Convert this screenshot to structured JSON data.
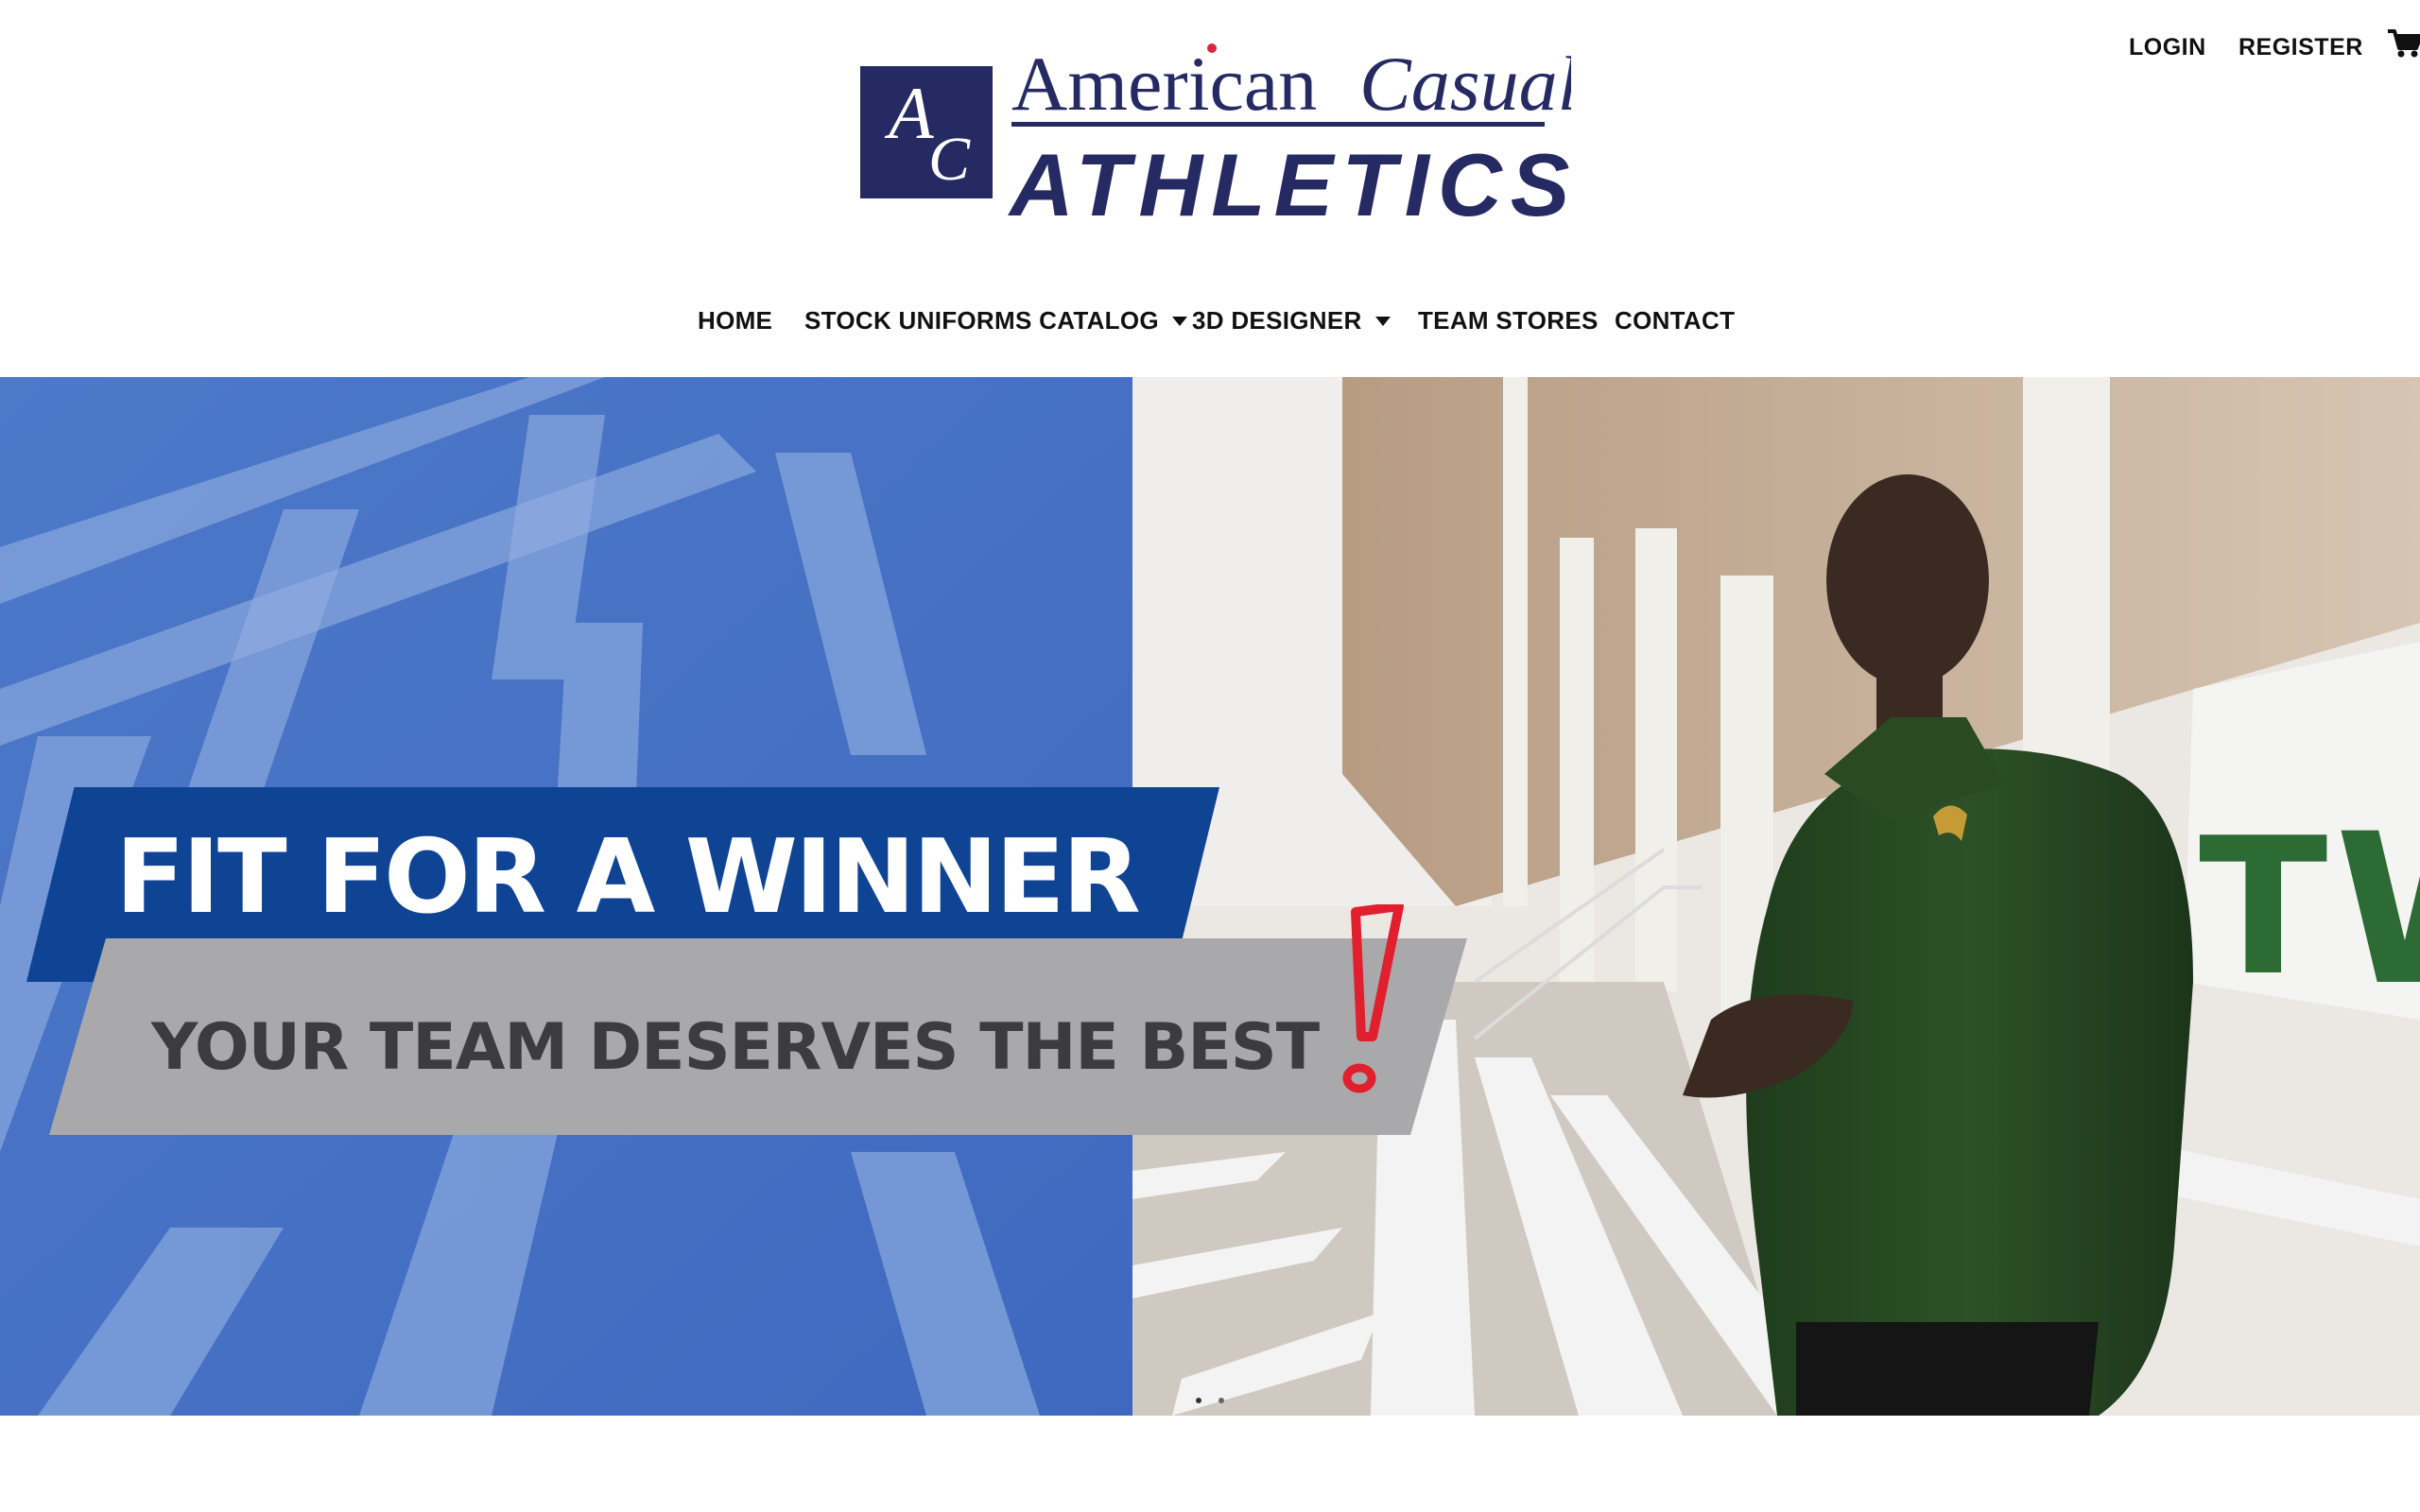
{
  "brand": {
    "monogram": "AC",
    "name_line1": "American",
    "name_line1_script": "Casual",
    "name_line2": "ATHLETICS",
    "color_navy": "#262a63",
    "color_red_dot": "#d7263d"
  },
  "account_nav": {
    "login": "LOGIN",
    "register": "REGISTER",
    "cart_icon": "shopping-cart-icon"
  },
  "main_nav": {
    "items": [
      {
        "label": "HOME"
      },
      {
        "label": "STOCK UNIFORMS CATALOG",
        "has_dropdown": true
      },
      {
        "label": "3D DESIGNER",
        "has_dropdown": true
      },
      {
        "label": "TEAM STORES"
      },
      {
        "label": "CONTACT"
      }
    ]
  },
  "hero": {
    "headline": "FIT FOR A WINNER",
    "subheadline": "YOUR TEAM DESERVES THE BEST",
    "accent_color": "#e0202e",
    "band_color": "#0f4495",
    "slides_count": 2,
    "active_slide": 1
  }
}
